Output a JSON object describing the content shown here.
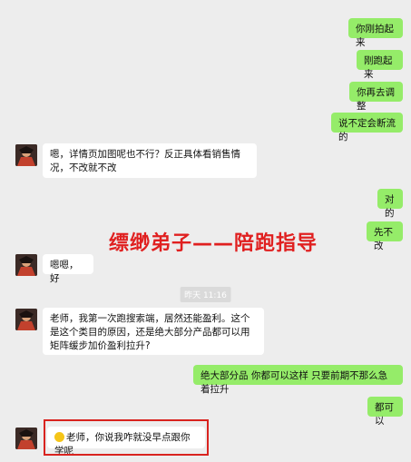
{
  "messages": [
    {
      "side": "right",
      "text": "你刚拍起来"
    },
    {
      "side": "right",
      "text": "刚跑起来"
    },
    {
      "side": "right",
      "text": "你再去调整"
    },
    {
      "side": "right",
      "text": "说不定会断流的"
    },
    {
      "side": "left",
      "text": "嗯，详情页加图呢也不行？反正具体看销售情况，不改就不改"
    },
    {
      "side": "right",
      "text": "对的"
    },
    {
      "side": "right",
      "text": "先不改"
    },
    {
      "side": "left",
      "text": "嗯嗯，好"
    },
    {
      "side": "left",
      "text": "老师，我第一次跑搜索端，居然还能盈利。这个是这个类目的原因，还是绝大部分产品都可以用矩阵缓步加价盈利拉升?"
    },
    {
      "side": "right",
      "text": "绝大部分品 你都可以这样 只要前期不那么急着拉升"
    },
    {
      "side": "right",
      "text": "都可以"
    },
    {
      "side": "left",
      "text": "老师，你说我咋就没早点跟你学呢",
      "emoji": "smiley-face-icon"
    }
  ],
  "timestamp": "昨天 11:16",
  "watermark": "缥缈弟子——陪跑指导",
  "colors": {
    "my_bubble": "#95ec69",
    "their_bubble": "#ffffff",
    "background": "#ededed",
    "highlight": "#d9231f"
  }
}
